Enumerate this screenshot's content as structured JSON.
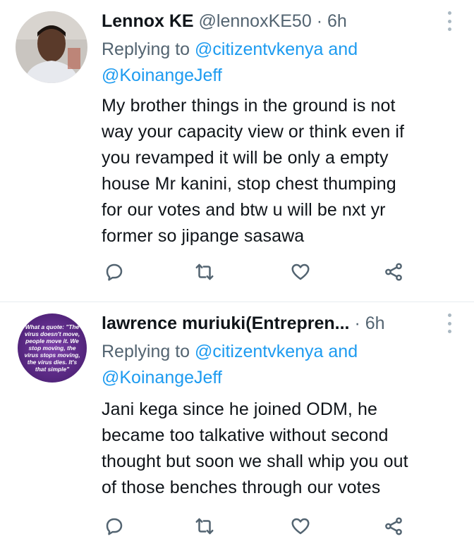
{
  "tweets": [
    {
      "display_name": "Lennox KE",
      "handle": "@lennoxKE50",
      "separator": "·",
      "time": "6h",
      "replying_prefix": "Replying to ",
      "mention_1": "@citizentvkenya",
      "mention_joiner": " and",
      "mention_2": "@KoinangeJeff",
      "body_lines": [
        "My brother things in the ground is not",
        "way your capacity view or think even if",
        "you revamped it will be only a empty",
        "house Mr kanini, stop chest thumping",
        "for our votes and btw u will be nxt yr",
        "former so jipange sasawa"
      ]
    },
    {
      "display_name": "lawrence muriuki(Entrepren...",
      "handle": "",
      "separator": "·",
      "time": "6h",
      "replying_prefix": "Replying to ",
      "mention_1": "@citizentvkenya",
      "mention_joiner": " and",
      "mention_2": "@KoinangeJeff",
      "body_lines": [
        "Jani kega since he joined ODM, he",
        "became too talkative without second",
        "thought but soon we shall  whip you out",
        "of those benches through our votes"
      ],
      "avatar_quote_lines": [
        "What a quote: \"The",
        "virus doesn't move,",
        "people move it. We",
        "stop moving, the",
        "virus stops moving,",
        "the virus dies. It's",
        "that simple\""
      ]
    }
  ],
  "icons": [
    "reply-icon",
    "retweet-icon",
    "like-icon",
    "share-icon",
    "more-icon"
  ],
  "colors": {
    "link": "#1d9bf0",
    "secondary": "#536471",
    "text": "#0f1419",
    "avatar_purple": "#5b2a86"
  }
}
